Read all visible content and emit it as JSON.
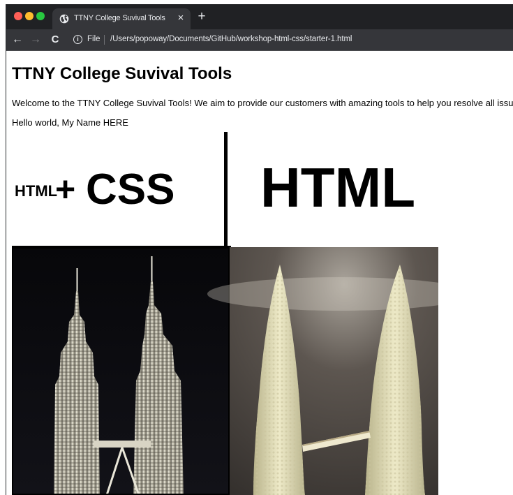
{
  "browser": {
    "tab": {
      "title": "TTNY College Suvival Tools",
      "favicon": "globe-icon",
      "close_label": "×"
    },
    "new_tab_label": "+",
    "toolbar": {
      "back_label": "←",
      "forward_label": "→",
      "reload_label": "C",
      "info_label": "i",
      "scheme_label": "File",
      "url": "/Users/popoway/Documents/GitHub/workshop-html-css/starter-1.html"
    }
  },
  "page": {
    "heading": "TTNY College Suvival Tools",
    "welcome": "Welcome to the TTNY College Suvival Tools! We aim to provide our customers with amazing tools to help you resolve all issu",
    "hello": "Hello world, My Name HERE",
    "meme": {
      "left_label_small": "HTML",
      "left_label_plus": "+",
      "left_label_big": "CSS",
      "right_label": "HTML"
    }
  },
  "colors": {
    "titlebar": "#202124",
    "tab": "#35363a",
    "text_light": "#e8eaed",
    "traffic_red": "#ff5f57",
    "traffic_yellow": "#febc2e",
    "traffic_green": "#28c840"
  }
}
